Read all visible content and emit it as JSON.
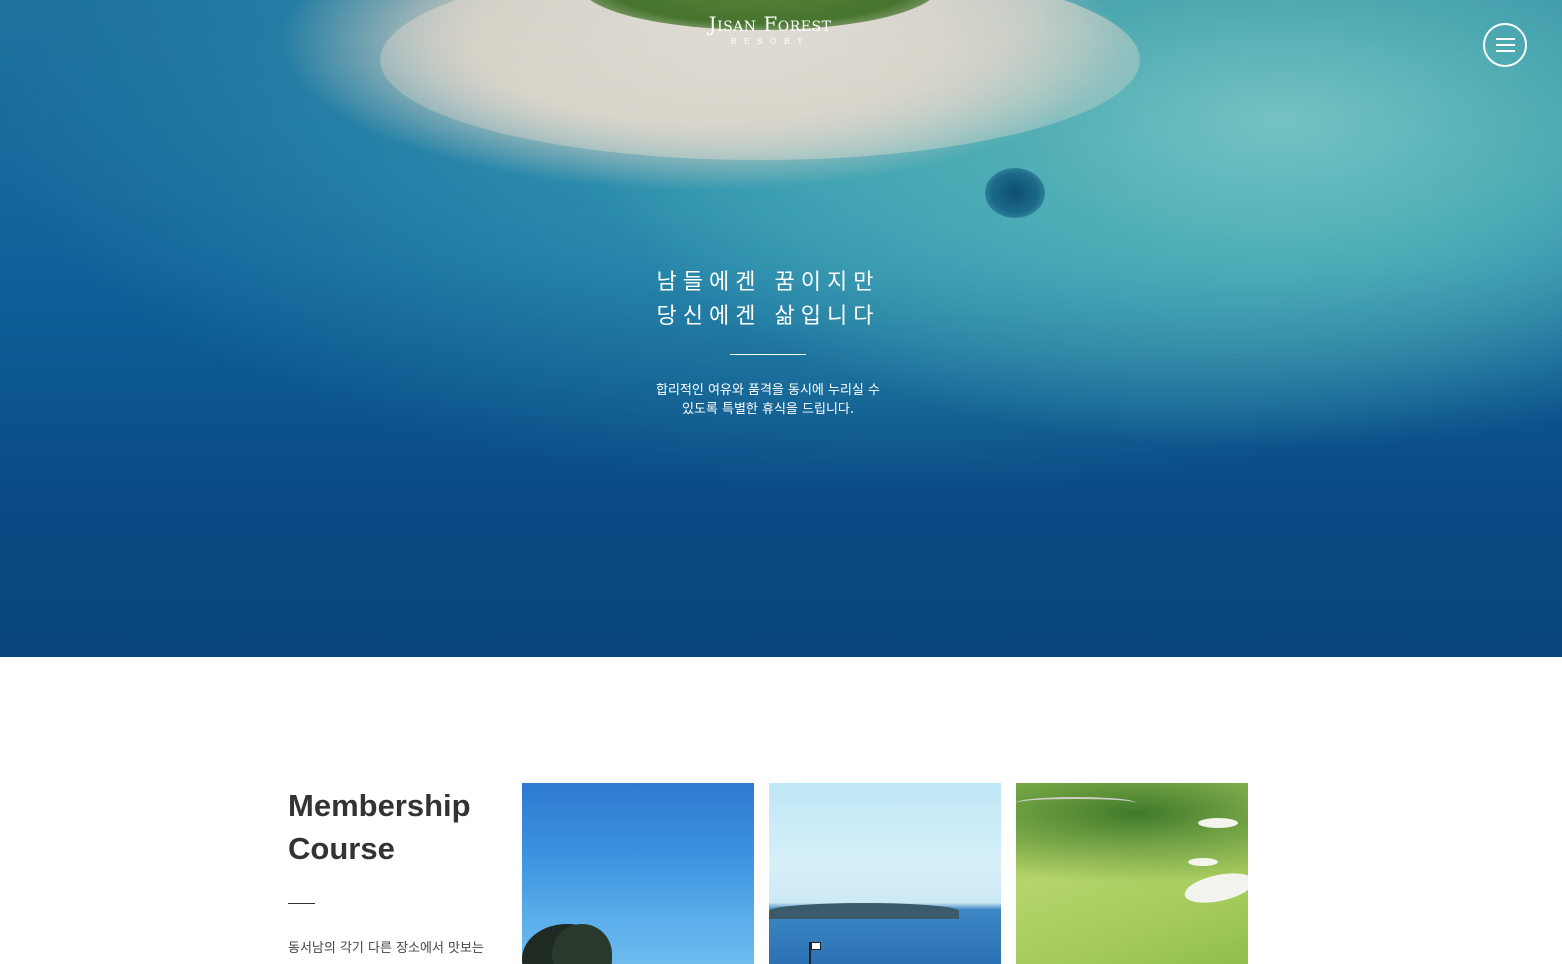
{
  "logo": {
    "main": "Jisan Forest",
    "sub": "RESORT"
  },
  "menu": {
    "icon": "hamburger-menu-icon"
  },
  "hero": {
    "title_line1": "남들에겐 꿈이지만",
    "title_line2": "당신에겐 삶입니다",
    "desc_line1": "합리적인 여유와 품격을 동시에 누리실 수",
    "desc_line2": "있도록 특별한 휴식을 드립니다."
  },
  "membership": {
    "title_line1": "Membership",
    "title_line2": "Course",
    "desc": "동서남의 각기 다른 장소에서 맛보는"
  },
  "cards": [
    {
      "name": "card-blue-sky-trees"
    },
    {
      "name": "card-seaside-course"
    },
    {
      "name": "card-green-fairway"
    }
  ],
  "colors": {
    "text_dark": "#333333",
    "white": "#ffffff"
  }
}
